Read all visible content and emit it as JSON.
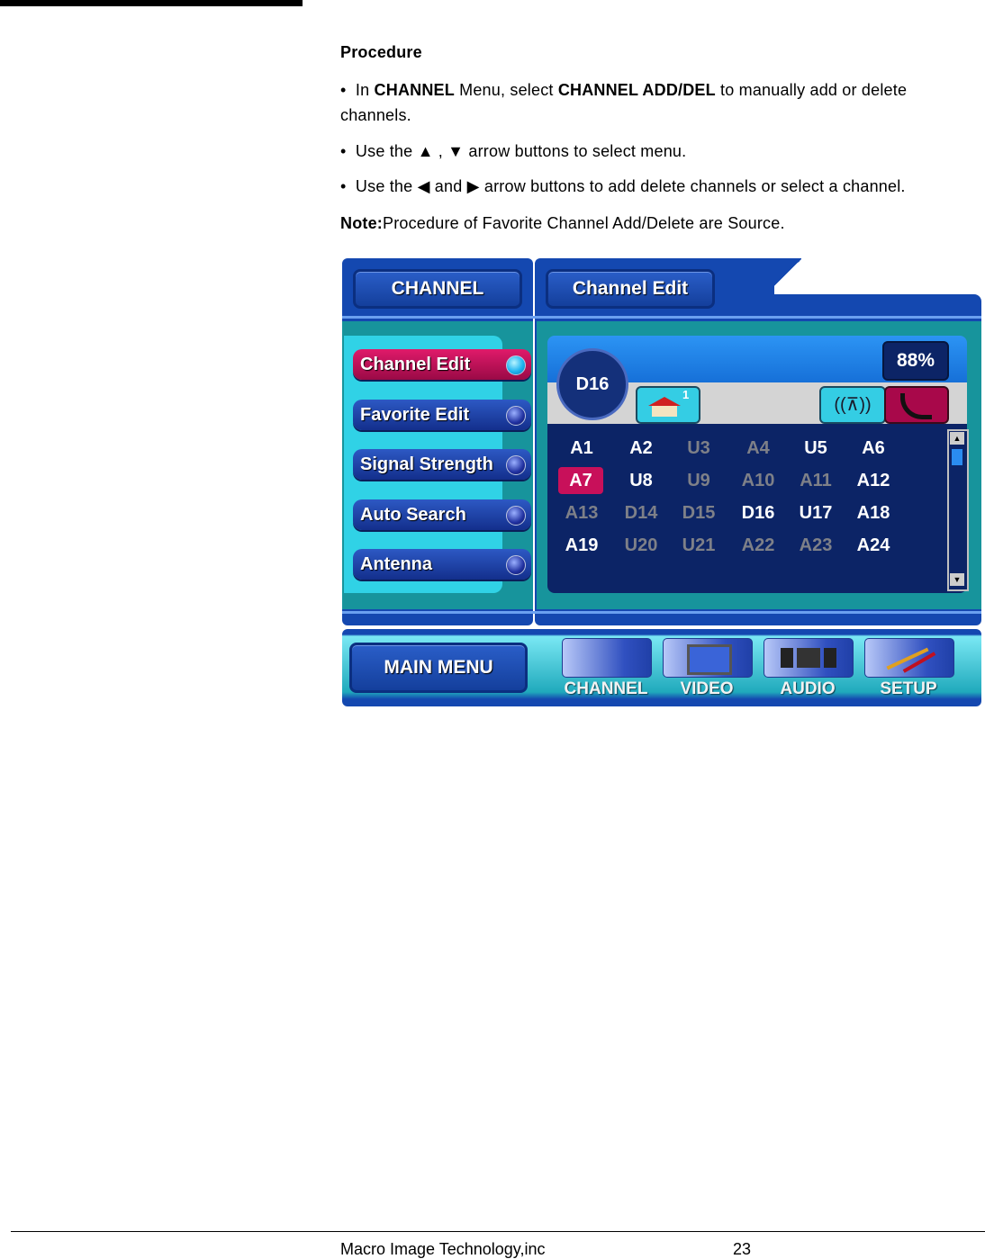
{
  "document": {
    "heading": "Procedure",
    "bullets": [
      {
        "parts": [
          "In ",
          "CHANNEL",
          " Menu, select ",
          "CHANNEL ADD/DEL",
          " to manually add or delete"
        ],
        "continuation": "channels."
      },
      {
        "prefix": "Use the ",
        "arrows": "▲ , ▼",
        "suffix": " arrow buttons to select menu."
      },
      {
        "prefix": "Use the ",
        "left": "◀",
        "mid": " and ",
        "right": "▶",
        "suffix": "  arrow buttons to add delete channels or select a channel."
      }
    ],
    "bullet_char": "•",
    "note_label": "Note:",
    "note_text": "Procedure of Favorite Channel Add/Delete are Source."
  },
  "osd": {
    "header_left": "CHANNEL",
    "header_right": "Channel Edit",
    "menu": [
      {
        "label": "Channel Edit",
        "active": true
      },
      {
        "label": "Favorite Edit",
        "active": false
      },
      {
        "label": "Signal Strength",
        "active": false
      },
      {
        "label": "Auto Search",
        "active": false
      },
      {
        "label": "Antenna",
        "active": false
      }
    ],
    "current_channel": "D16",
    "signal_percent": "88%",
    "icons": {
      "antenna_house": "house-antenna-icon",
      "antenna_number": "1",
      "broadcast": "broadcast-tower-icon",
      "cable": "cable-icon"
    },
    "channels": [
      [
        {
          "l": "A1",
          "s": "on"
        },
        {
          "l": "A2",
          "s": "on"
        },
        {
          "l": "U3",
          "s": "off"
        },
        {
          "l": "A4",
          "s": "off"
        },
        {
          "l": "U5",
          "s": "on"
        },
        {
          "l": "A6",
          "s": "on"
        }
      ],
      [
        {
          "l": "A7",
          "s": "sel"
        },
        {
          "l": "U8",
          "s": "on"
        },
        {
          "l": "U9",
          "s": "off"
        },
        {
          "l": "A10",
          "s": "off"
        },
        {
          "l": "A11",
          "s": "off"
        },
        {
          "l": "A12",
          "s": "on"
        }
      ],
      [
        {
          "l": "A13",
          "s": "off"
        },
        {
          "l": "D14",
          "s": "off"
        },
        {
          "l": "D15",
          "s": "off"
        },
        {
          "l": "D16",
          "s": "on"
        },
        {
          "l": "U17",
          "s": "on"
        },
        {
          "l": "A18",
          "s": "on"
        }
      ],
      [
        {
          "l": "A19",
          "s": "on"
        },
        {
          "l": "U20",
          "s": "off"
        },
        {
          "l": "U21",
          "s": "off"
        },
        {
          "l": "A22",
          "s": "off"
        },
        {
          "l": "A23",
          "s": "off"
        },
        {
          "l": "A24",
          "s": "on"
        }
      ]
    ],
    "main_menu": "MAIN MENU",
    "nav": [
      {
        "label": "CHANNEL",
        "icon": "remote-control-icon"
      },
      {
        "label": "VIDEO",
        "icon": "tv-icon"
      },
      {
        "label": "AUDIO",
        "icon": "stereo-icon"
      },
      {
        "label": "SETUP",
        "icon": "tools-icon"
      }
    ]
  },
  "footer": {
    "company": "Macro Image Technology,inc",
    "page_number": "23"
  }
}
